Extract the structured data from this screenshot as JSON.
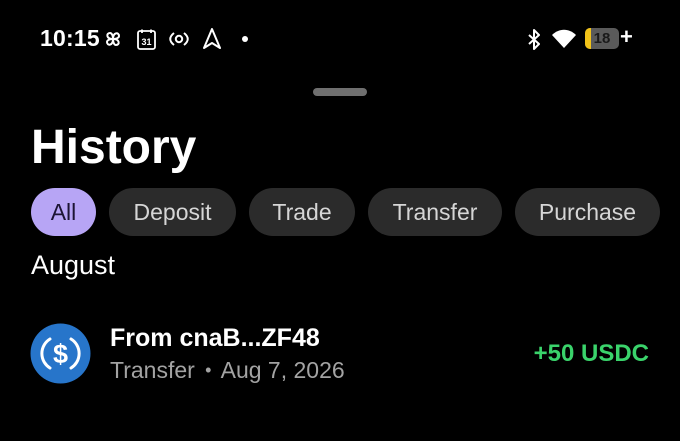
{
  "status_bar": {
    "time": "10:15",
    "calendar_day": "31",
    "battery_level": "18",
    "battery_fraction": 0.18,
    "icons": [
      "pinwheel-icon",
      "calendar-icon",
      "hotspot-icon",
      "location-arrow-icon",
      "dot-icon",
      "bluetooth-icon",
      "wifi-icon",
      "battery-icon",
      "charging-plus-icon"
    ]
  },
  "header": {
    "title": "History"
  },
  "filters": {
    "selected": "All",
    "items": [
      {
        "label": "All"
      },
      {
        "label": "Deposit"
      },
      {
        "label": "Trade"
      },
      {
        "label": "Transfer"
      },
      {
        "label": "Purchase"
      }
    ]
  },
  "sections": [
    {
      "header": "August",
      "transactions": [
        {
          "title": "From cnaB...ZF48",
          "type": "Transfer",
          "separator": "•",
          "date": "Aug 7, 2026",
          "amount": "+50 USDC",
          "icon": "usdc-coin-icon"
        }
      ]
    }
  ],
  "colors": {
    "background": "#000000",
    "chip_active": "#b7a5f5",
    "chip_inactive": "#2b2b2b",
    "amount_positive": "#3ad36b",
    "usdc_blue": "#2775ca",
    "battery_fill": "#f2c318"
  }
}
